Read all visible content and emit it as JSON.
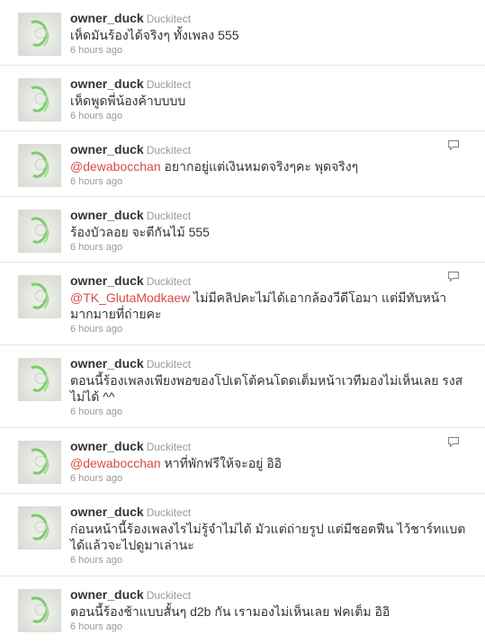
{
  "tweets": [
    {
      "user": "owner_duck",
      "name": "Duckitect",
      "mention": "",
      "text": "เห็ดมันร้องได้จริงๆ ทั้งเพลง 555",
      "time": "6 hours ago",
      "reply": false
    },
    {
      "user": "owner_duck",
      "name": "Duckitect",
      "mention": "",
      "text": "เห็ดพูดพี่น้องค้าบบบบ",
      "time": "6 hours ago",
      "reply": false
    },
    {
      "user": "owner_duck",
      "name": "Duckitect",
      "mention": "@dewabocchan",
      "text": " อยากอยู่แต่เงินหมดจริงๆคะ พุดจริงๆ",
      "time": "6 hours ago",
      "reply": true
    },
    {
      "user": "owner_duck",
      "name": "Duckitect",
      "mention": "",
      "text": "ร้องบัวลอย จะตีกันไม้ 555",
      "time": "6 hours ago",
      "reply": false
    },
    {
      "user": "owner_duck",
      "name": "Duckitect",
      "mention": "@TK_GlutaModkaew",
      "text": " ไม่มีคลิปคะไม่ได้เอากล้องวีดีโอมา แต่มีทับหน้ามากมายที่ถ่ายคะ",
      "time": "6 hours ago",
      "reply": true
    },
    {
      "user": "owner_duck",
      "name": "Duckitect",
      "mention": "",
      "text": "ตอนนี้ร้องเพลงเพียงพอของโปเตโต้คนโดดเต็มหน้าเวทีมองไม่เห็นเลย รงส ไม่ได้ ^^",
      "time": "6 hours ago",
      "reply": false
    },
    {
      "user": "owner_duck",
      "name": "Duckitect",
      "mention": "@dewabocchan",
      "text": " หาที่พักฟรีให้จะอยู่ อิอิ",
      "time": "6 hours ago",
      "reply": true
    },
    {
      "user": "owner_duck",
      "name": "Duckitect",
      "mention": "",
      "text": "ก่อนหน้านี้ร้องเพลงไรไม่รู้จำไม่ได้ มัวแต่ถ่ายรูป แต่มีชอตฟืน ไว้ชาร์ทแบตได้แล้วจะไปดูมาเล่านะ",
      "time": "6 hours ago",
      "reply": false
    },
    {
      "user": "owner_duck",
      "name": "Duckitect",
      "mention": "",
      "text": "ตอนนี้ร้องช้าแบบสั้นๆ d2b กัน เรามองไม่เห็นเลย ฟคเต็ม อิอิ",
      "time": "6 hours ago",
      "reply": false
    }
  ]
}
